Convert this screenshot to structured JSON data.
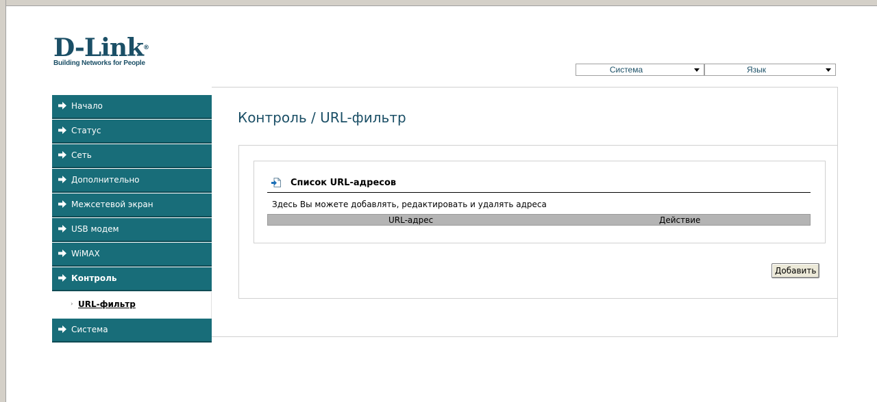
{
  "brand": {
    "logo_text": "D-Link",
    "tagline": "Building Networks for People"
  },
  "top_selects": {
    "system_label": "Система",
    "language_label": "Язык"
  },
  "sidebar": {
    "items": [
      {
        "label": "Начало"
      },
      {
        "label": "Статус"
      },
      {
        "label": "Сеть"
      },
      {
        "label": "Дополнительно"
      },
      {
        "label": "Межсетевой экран"
      },
      {
        "label": "USB модем"
      },
      {
        "label": "WiMAX"
      },
      {
        "label": "Контроль"
      },
      {
        "label": "Система"
      }
    ],
    "active_item": "Контроль",
    "sub_items": [
      {
        "label": "URL-фильтр"
      }
    ]
  },
  "page": {
    "title": "Контроль / URL-фильтр"
  },
  "url_list": {
    "title": "Список URL-адресов",
    "description": "Здесь Вы можете добавлять, редактировать и удалять адреса",
    "columns": [
      "URL-адрес",
      "Действие"
    ],
    "rows": []
  },
  "actions": {
    "add_label": "Добавить"
  },
  "colors": {
    "nav_bg": "#186d79",
    "brand": "#1b4f66",
    "table_header_bg": "#b4b4b4"
  }
}
